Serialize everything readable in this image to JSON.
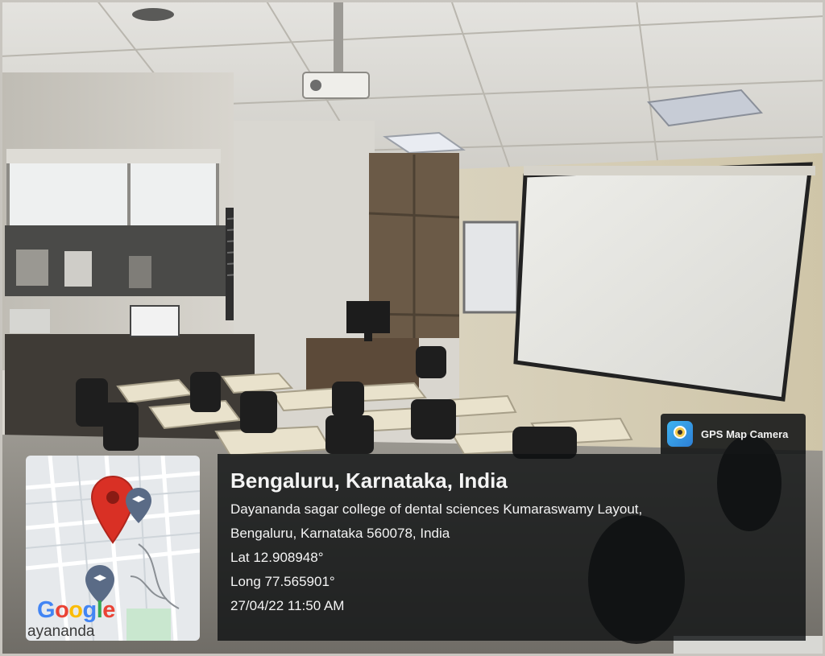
{
  "badge": {
    "app_name": "GPS Map Camera",
    "icon": "gps-map-camera-icon"
  },
  "location": {
    "city": "Bengaluru, Karnataka, India",
    "address_line1": "Dayananda sagar college of dental sciences Kumaraswamy Layout,",
    "address_line2": "Bengaluru, Karnataka 560078, India",
    "latitude": "Lat 12.908948°",
    "longitude": "Long 77.565901°",
    "timestamp": "27/04/22 11:50 AM"
  },
  "map": {
    "provider_logo": [
      "G",
      "o",
      "o",
      "g",
      "l",
      "e"
    ],
    "logo_colors": [
      "#4285F4",
      "#EA4335",
      "#FBBC05",
      "#4285F4",
      "#34A853",
      "#EA4335"
    ],
    "place_label": "ayananda",
    "pin_color": "#D93025",
    "marker_color": "#5A6B86"
  }
}
